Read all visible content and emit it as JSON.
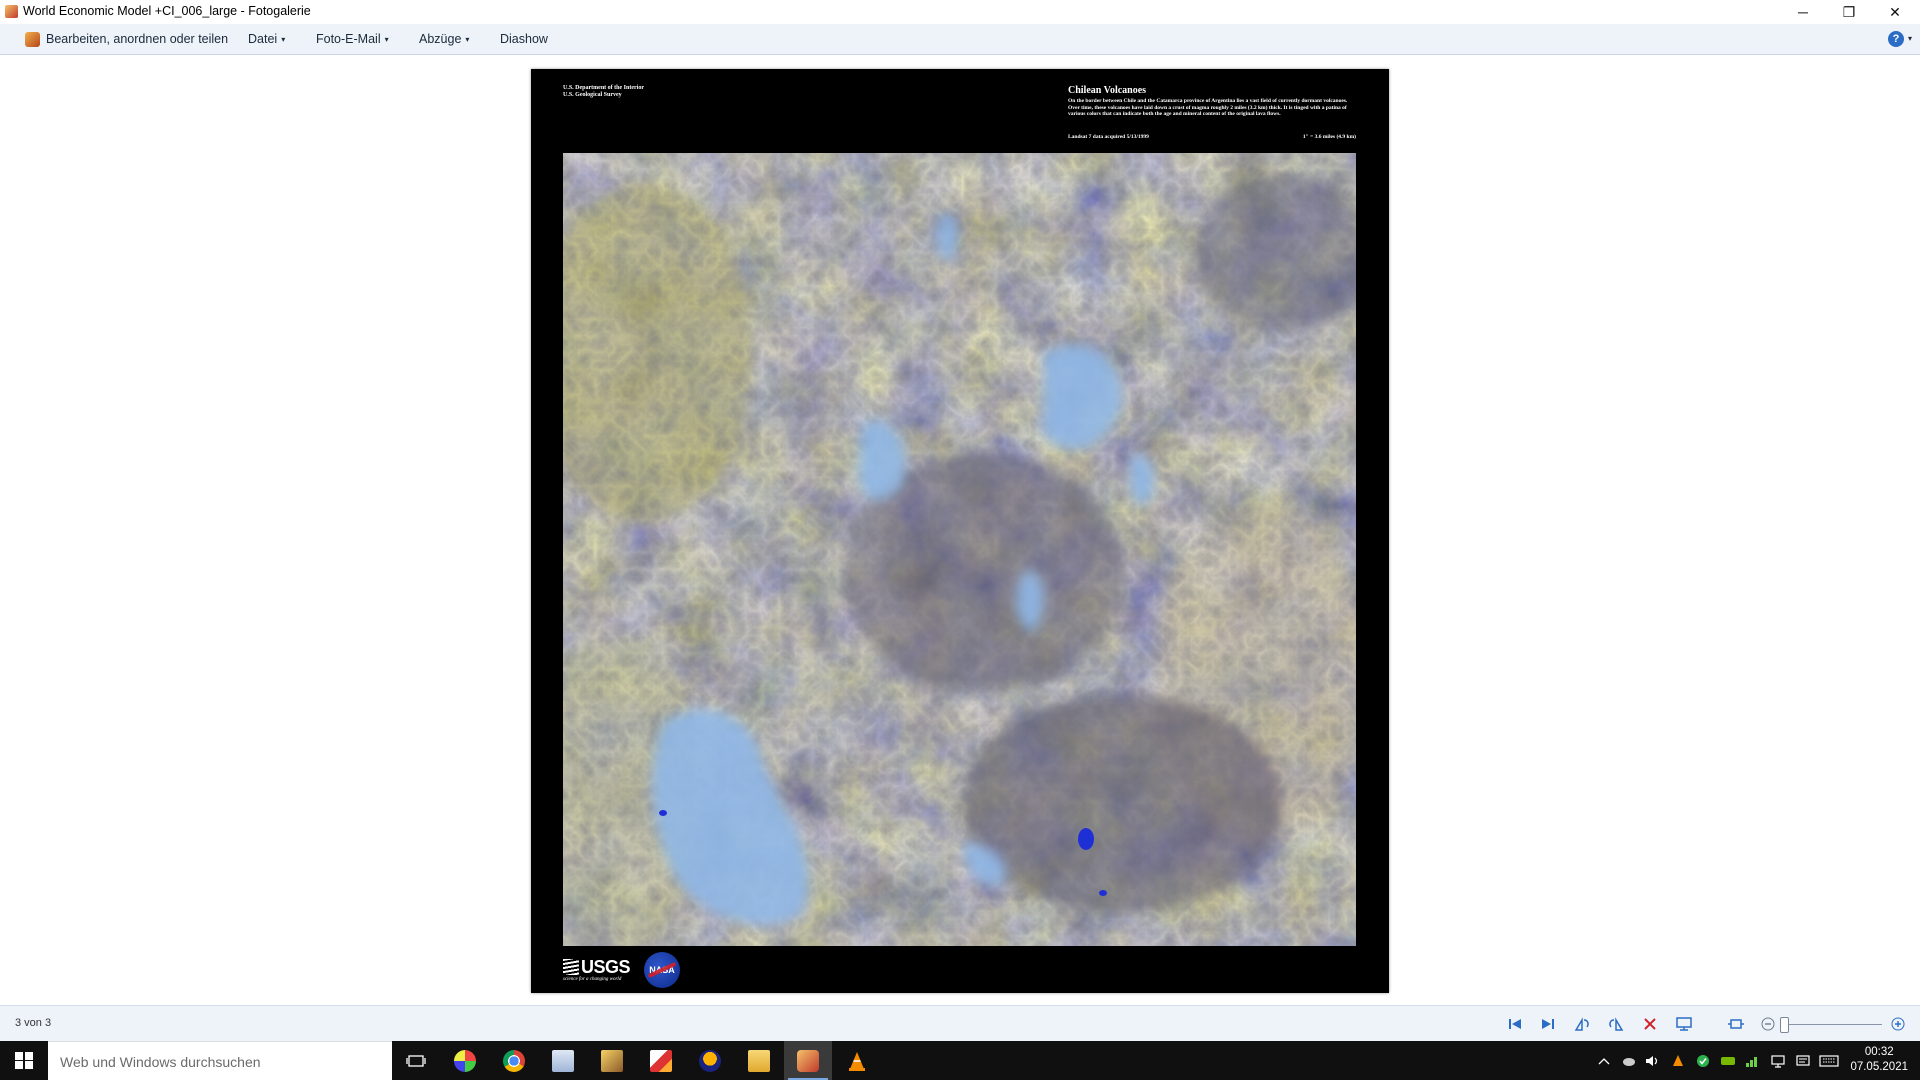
{
  "window": {
    "title": "World Economic Model +CI_006_large - Fotogalerie",
    "minimize_glyph": "─",
    "restore_glyph": "❐",
    "close_glyph": "✕"
  },
  "menu": {
    "organize_label": "Bearbeiten, anordnen oder teilen",
    "file_label": "Datei",
    "email_label": "Foto-E-Mail",
    "prints_label": "Abzüge",
    "slideshow_label": "Diashow",
    "caret": "▾",
    "help_glyph": "?"
  },
  "poster": {
    "agency_line1": "U.S. Department of the Interior",
    "agency_line2": "U.S. Geological Survey",
    "title": "Chilean Volcanoes",
    "description": "On the border between Chile and the Catamarca province of Argentina lies a vast field of currently dormant volcanoes. Over time, these volcanoes have laid down a crust of magma roughly 2 miles (3.2 km) thick. It is tinged with a patina of various colors that can indicate both the age and mineral content of the original lava flows.",
    "acquired": "Landsat 7 data acquired 5/13/1999",
    "scale": "1\" = 3.6 miles (4.9 km)",
    "usgs_logo_text": "USGS",
    "usgs_tagline": "science for a changing world",
    "nasa_logo_text": "NASA"
  },
  "status": {
    "position": "3 von 3"
  },
  "taskbar": {
    "search_placeholder": "Web und Windows durchsuchen",
    "clock_time": "00:32",
    "clock_date": "07.05.2021"
  },
  "colors": {
    "menubar": "#eef3fa",
    "accent": "#2b6cc4",
    "taskbar": "#101010"
  }
}
